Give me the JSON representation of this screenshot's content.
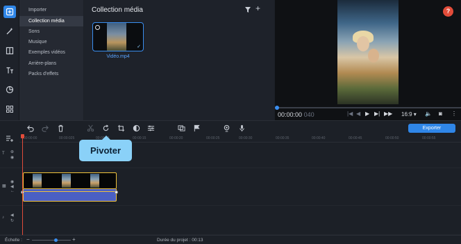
{
  "colors": {
    "accent": "#2f86e8",
    "clip_border": "#f0c23b",
    "audio_clip": "#4a5fc3",
    "playhead": "#e24c3a",
    "tooltip_bg": "#8ad1f8"
  },
  "rail": {
    "icons": [
      "import-icon",
      "magic-wand-icon",
      "transitions-icon",
      "titles-icon",
      "stickers-icon",
      "grid-icon"
    ]
  },
  "menu": {
    "items": [
      {
        "label": "Importer"
      },
      {
        "label": "Collection média"
      },
      {
        "label": "Sons"
      },
      {
        "label": "Musique"
      },
      {
        "label": "Exemples vidéos"
      },
      {
        "label": "Arrière-plans"
      },
      {
        "label": "Packs d'effets"
      }
    ]
  },
  "media": {
    "title": "Collection média",
    "file_name": "Vidéo.mp4",
    "add_symbol": "+"
  },
  "preview": {
    "help": "?",
    "timecode": "00:00:00",
    "timecode_frames": "040",
    "aspect": "16:9 ▾"
  },
  "toolbar": {
    "export_label": "Exporter"
  },
  "timeline": {
    "ticks": [
      "00:00:00",
      "00:00:025",
      "00:00:10",
      "00:00:15",
      "00:00:20",
      "00:00:25",
      "00:00:30",
      "00:00:35",
      "00:00:40",
      "00:00:45",
      "00:00:50",
      "00:00:55"
    ]
  },
  "tooltip": {
    "label": "Pivoter"
  },
  "status": {
    "scale_label": "Échelle :",
    "zoom_level": 0.6,
    "duration": "Durée du projet :  00:13"
  }
}
